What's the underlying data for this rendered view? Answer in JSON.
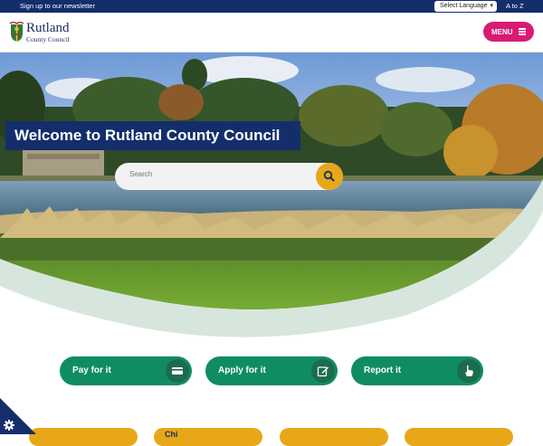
{
  "topbar": {
    "newsletter_link": "Sign up to our newsletter",
    "language_select": "Select Language",
    "atoz_link": "A to Z"
  },
  "header": {
    "logo_name": "Rutland",
    "logo_sub": "County Council",
    "menu_label": "MENU"
  },
  "hero": {
    "welcome": "Welcome to Rutland County Council",
    "search_placeholder": "Search"
  },
  "actions": [
    {
      "label": "Pay for it",
      "icon": "card-icon"
    },
    {
      "label": "Apply for it",
      "icon": "edit-icon"
    },
    {
      "label": "Report it",
      "icon": "hand-point-icon"
    }
  ],
  "tiles": [
    "",
    "Chi",
    "",
    ""
  ],
  "colors": {
    "navy": "#142e6b",
    "menu_pink": "#d81b73",
    "action_green": "#0f8c63",
    "search_yellow": "#e8a718",
    "hero_curve": "#d6e6dc"
  }
}
